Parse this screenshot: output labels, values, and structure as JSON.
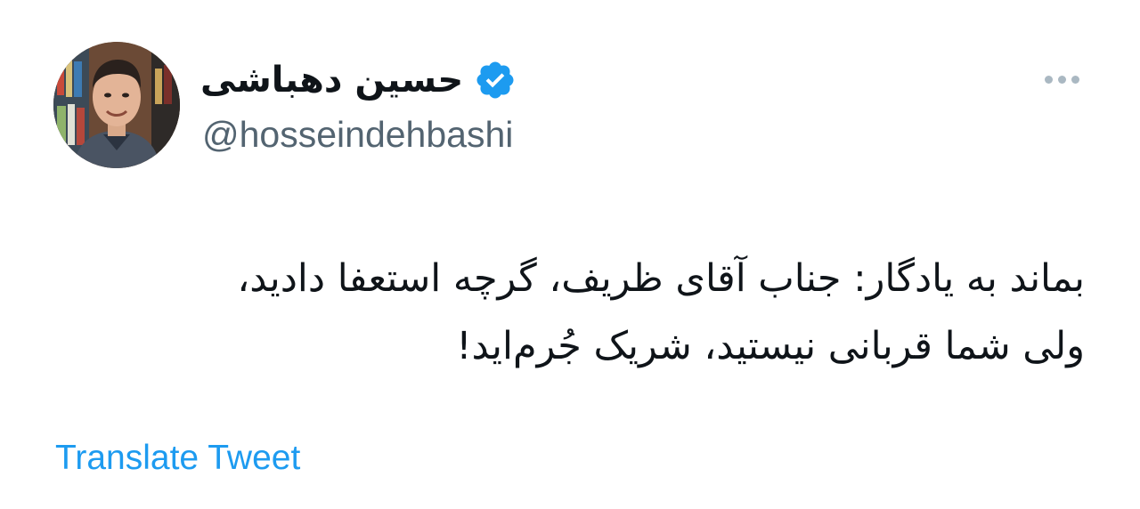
{
  "tweet": {
    "author": {
      "display_name": "حسین دهباشی",
      "handle": "@hosseindehbashi",
      "verified": true,
      "avatar_icon": "profile-photo"
    },
    "body_lines": [
      "بماند به یادگار: جناب آقای ظریف، گرچه استعفا دادید،",
      "ولی شما قربانی نیستید، شریک جُرم‌اید!"
    ],
    "translate_label": "Translate Tweet",
    "more_icon": "more-horizontal-icon"
  },
  "colors": {
    "text_primary": "#0f1419",
    "text_secondary": "#536471",
    "accent": "#1d9bf0",
    "more_dots": "#aab8c2"
  }
}
